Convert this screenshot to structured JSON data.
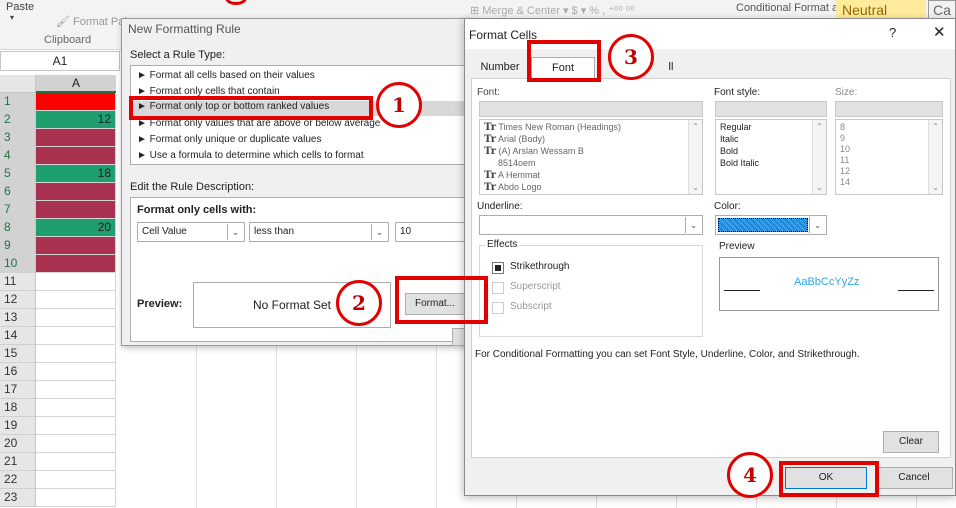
{
  "ribbon": {
    "paste_label": "Paste",
    "paste_arrow": "▾",
    "format_painter": "Format Pai",
    "clipboard_label": "Clipboard",
    "middle_fragment": "⊞ Merge & Center ▾   $ ▾ %  ,   ⁺⁰⁰ ⁰⁰",
    "conditional_label": "Conditional  Format as",
    "neutral_label": "Neutral",
    "ca_label": "Ca"
  },
  "name_box": {
    "value": "A1"
  },
  "grid": {
    "column_header": "A",
    "rows": [
      {
        "num": "1",
        "value": "",
        "color": "#ff0000"
      },
      {
        "num": "2",
        "value": "12",
        "color": "#1f9f6f"
      },
      {
        "num": "3",
        "value": "",
        "color": "#a8324f"
      },
      {
        "num": "4",
        "value": "",
        "color": "#a8324f"
      },
      {
        "num": "5",
        "value": "18",
        "color": "#1f9f6f"
      },
      {
        "num": "6",
        "value": "",
        "color": "#a8324f"
      },
      {
        "num": "7",
        "value": "",
        "color": "#a8324f"
      },
      {
        "num": "8",
        "value": "20",
        "color": "#1f9f6f"
      },
      {
        "num": "9",
        "value": "",
        "color": "#a8324f"
      },
      {
        "num": "10",
        "value": "",
        "color": "#a8324f"
      },
      {
        "num": "11",
        "value": "",
        "color": ""
      },
      {
        "num": "12",
        "value": "",
        "color": ""
      },
      {
        "num": "13",
        "value": "",
        "color": ""
      },
      {
        "num": "14",
        "value": "",
        "color": ""
      },
      {
        "num": "15",
        "value": "",
        "color": ""
      },
      {
        "num": "16",
        "value": "",
        "color": ""
      },
      {
        "num": "17",
        "value": "",
        "color": ""
      },
      {
        "num": "18",
        "value": "",
        "color": ""
      },
      {
        "num": "19",
        "value": "",
        "color": ""
      },
      {
        "num": "20",
        "value": "",
        "color": ""
      },
      {
        "num": "21",
        "value": "",
        "color": ""
      },
      {
        "num": "22",
        "value": "",
        "color": ""
      },
      {
        "num": "23",
        "value": "",
        "color": ""
      }
    ]
  },
  "new_rule_dialog": {
    "title": "New Formatting Rule",
    "select_label": "Select a Rule Type:",
    "rule_types": [
      "► Format all cells based on their values",
      "► Format only cells that contain",
      "► Format only top or bottom ranked values",
      "► Format only values that are above or below average",
      "► Format only unique or duplicate values",
      "► Use a formula to determine which cells to format"
    ],
    "edit_label": "Edit the Rule Description:",
    "format_only_label": "Format only cells with:",
    "cell_value": "Cell Value",
    "operator": "less than",
    "value": "10",
    "preview_label": "Preview:",
    "preview_text": "No Format Set",
    "format_button": "Format..."
  },
  "format_cells_dialog": {
    "title": "Format Cells",
    "help": "?",
    "close": "✕",
    "tabs": {
      "number": "Number",
      "font": "Font",
      "fill_fragment": "ll"
    },
    "font_label": "Font:",
    "fonts": [
      {
        "icon": "Tr",
        "name": "Times New Roman (Headings)"
      },
      {
        "icon": "Tr",
        "name": "Arial (Body)"
      },
      {
        "icon": "Tr",
        "name": "(A) Arslan Wessam B"
      },
      {
        "icon": "",
        "name": "8514oem"
      },
      {
        "icon": "Tr",
        "name": "A Hemmat"
      },
      {
        "icon": "Tr",
        "name": "Abdo Logo"
      }
    ],
    "style_label": "Font style:",
    "styles": [
      "Regular",
      "Italic",
      "Bold",
      "Bold Italic"
    ],
    "size_label": "Size:",
    "sizes": [
      "8",
      "9",
      "10",
      "11",
      "12",
      "14"
    ],
    "underline_label": "Underline:",
    "color_label": "Color:",
    "effects_label": "Effects",
    "strikethrough": "Strikethrough",
    "superscript": "Superscript",
    "subscript": "Subscript",
    "preview_label": "Preview",
    "preview_text": "AaBbCcYyZz",
    "note": "For Conditional Formatting you can set Font Style, Underline, Color, and Strikethrough.",
    "clear_button": "Clear",
    "ok_button": "OK",
    "cancel_button": "Cancel",
    "selected_color": "#2f95e3",
    "preview_color": "#2aa8e8"
  },
  "annotations": {
    "step1": "1",
    "step2": "2",
    "step3": "3",
    "step4": "4",
    "color": "#e20000"
  },
  "scroll_up": "⌃",
  "scroll_down": "⌄",
  "dropdown_arrow": "⌄"
}
